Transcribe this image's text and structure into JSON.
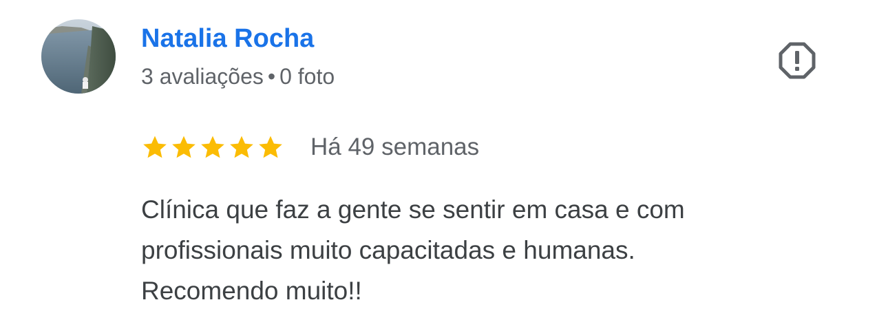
{
  "review": {
    "author": {
      "name": "Natalia Rocha",
      "reviews_count": "3 avaliações",
      "separator": "•",
      "photos_count": "0 foto"
    },
    "rating": 5,
    "rating_max": 5,
    "date": "Há 49 semanas",
    "text_lines": [
      "Clínica que faz a gente se sentir em casa e com",
      "profissionais muito capacitadas e humanas.",
      "Recomendo muito!!"
    ],
    "report_icon": "report-flag-octagon-icon"
  },
  "colors": {
    "author_link": "#1a73e8",
    "secondary_text": "#5f6368",
    "body_text": "#3c4043",
    "star": "#fbbc04",
    "icon": "#5f6368"
  }
}
